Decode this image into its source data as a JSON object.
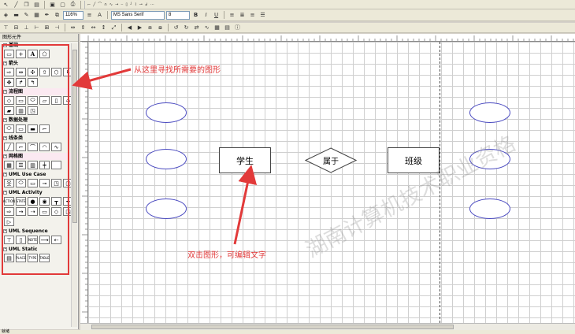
{
  "toolbar2": {
    "zoom": "116%",
    "font_name": "MS Sans Serif",
    "font_size": "8"
  },
  "panel": {
    "title": "图形元件",
    "categories": [
      {
        "label": "基础",
        "highlight": false
      },
      {
        "label": "箭头",
        "highlight": false
      },
      {
        "label": "流程图",
        "highlight": true
      },
      {
        "label": "数据处理",
        "highlight": false
      },
      {
        "label": "线条类",
        "highlight": false
      },
      {
        "label": "网格图",
        "highlight": true
      },
      {
        "label": "UML Use Case",
        "highlight": false
      },
      {
        "label": "UML Activity",
        "highlight": false
      },
      {
        "label": "UML Sequence",
        "highlight": false
      },
      {
        "label": "UML Static",
        "highlight": false
      }
    ],
    "shape_labels": [
      "ACTION",
      "STATE",
      "NOTE",
      "PLACE",
      "TYPE",
      "TABLE"
    ]
  },
  "canvas": {
    "entity_student": "学生",
    "relation": "属于",
    "entity_class": "班级"
  },
  "annotations": {
    "top": "从这里寻找所需要的图形",
    "bottom": "双击图形，可编辑文字"
  },
  "watermark": "湖南计算机技术职业资格",
  "status": "就绪",
  "colors": {
    "annotation_red": "#e23a3a",
    "ellipse_border": "#4a4ac0"
  }
}
